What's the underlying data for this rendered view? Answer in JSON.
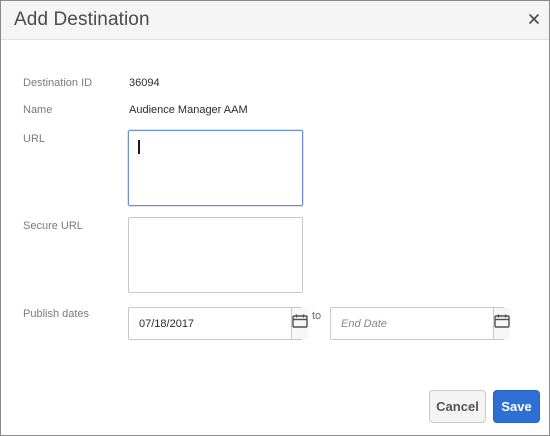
{
  "dialog": {
    "title": "Add Destination"
  },
  "fields": {
    "destination_id": {
      "label": "Destination ID",
      "value": "36094"
    },
    "name": {
      "label": "Name",
      "value": "Audience Manager AAM"
    },
    "url": {
      "label": "URL",
      "value": ""
    },
    "secure_url": {
      "label": "Secure URL",
      "value": ""
    },
    "publish_dates": {
      "label": "Publish dates",
      "start_value": "07/18/2017",
      "separator": "to",
      "end_placeholder": "End Date"
    }
  },
  "buttons": {
    "cancel": "Cancel",
    "save": "Save"
  },
  "colors": {
    "primary": "#2d6fd3",
    "focus_border": "#6a8fd4",
    "label": "#7b7b7b",
    "header_bg": "#f5f5f5"
  },
  "icons": {
    "close": "close-icon",
    "calendar": "calendar-icon"
  }
}
